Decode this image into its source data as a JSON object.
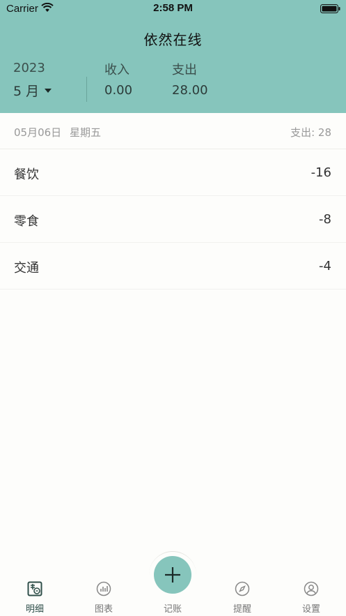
{
  "status_bar": {
    "carrier": "Carrier",
    "time": "2:58 PM"
  },
  "header": {
    "title": "依然在线",
    "year": "2023",
    "month": "5 月",
    "income_label": "收入",
    "income_value": "0.00",
    "expense_label": "支出",
    "expense_value": "28.00"
  },
  "day": {
    "date": "05月06日",
    "weekday": "星期五",
    "total": "支出: 28"
  },
  "records": [
    {
      "name": "餐饮",
      "amount": "-16"
    },
    {
      "name": "零食",
      "amount": "-8"
    },
    {
      "name": "交通",
      "amount": "-4"
    }
  ],
  "tabbar": {
    "tabs": [
      {
        "label": "明细",
        "icon": "detail-icon"
      },
      {
        "label": "图表",
        "icon": "chart-icon"
      },
      {
        "label": "记账",
        "icon": "plus-icon"
      },
      {
        "label": "提醒",
        "icon": "compass-icon"
      },
      {
        "label": "设置",
        "icon": "user-icon"
      }
    ]
  },
  "colors": {
    "accent": "#86c5bc",
    "background": "#fdfdfb",
    "muted_text": "#999999"
  }
}
